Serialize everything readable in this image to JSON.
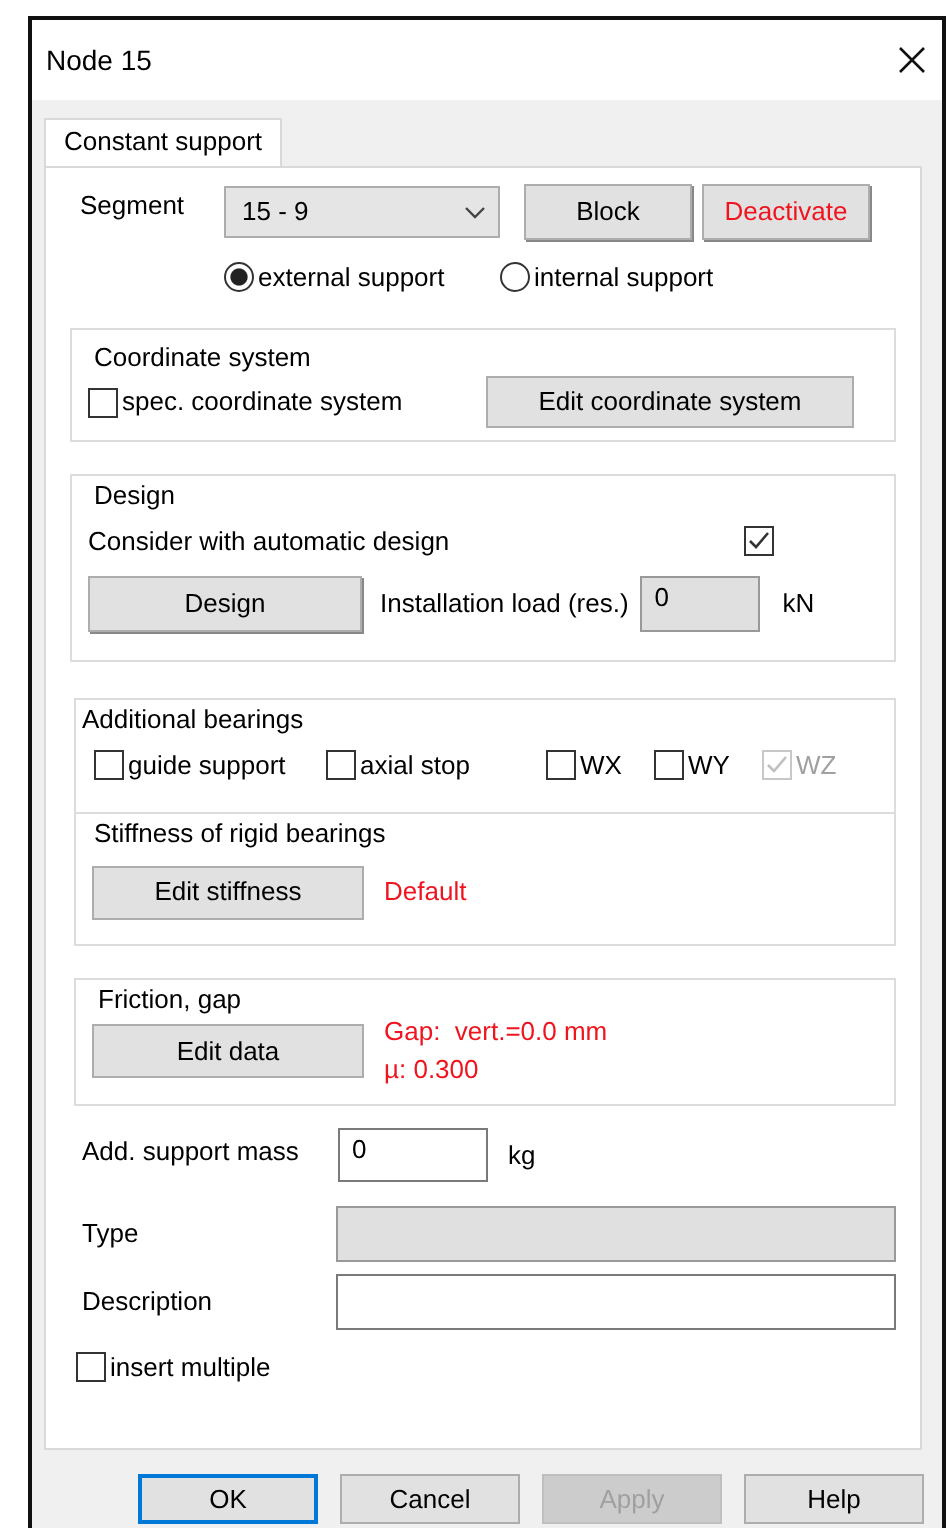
{
  "window": {
    "title": "Node 15"
  },
  "tabs": [
    {
      "label": "Constant support",
      "selected": true
    }
  ],
  "segment": {
    "label": "Segment",
    "value": "15 - 9"
  },
  "segment_buttons": [
    {
      "label": "Block",
      "kind": "normal"
    },
    {
      "label": "Deactivate",
      "kind": "warning"
    }
  ],
  "support_type": [
    {
      "label": "external support",
      "selected": true
    },
    {
      "label": "internal support",
      "selected": false
    }
  ],
  "coordinate_system": {
    "title": "Coordinate system",
    "checkbox": {
      "label": "spec. coordinate system",
      "checked": false
    },
    "button": "Edit coordinate system"
  },
  "design": {
    "title": "Design",
    "consider": {
      "label": "Consider with automatic design",
      "checked": true
    },
    "button": "Design",
    "load_label": "Installation load (res.)",
    "load_value": "0",
    "unit": "kN"
  },
  "additional_bearings": {
    "title": "Additional bearings",
    "options": [
      {
        "label": "guide support",
        "checked": false,
        "disabled": false
      },
      {
        "label": "axial stop",
        "checked": false,
        "disabled": false
      },
      {
        "label": "WX",
        "checked": false,
        "disabled": false
      },
      {
        "label": "WY",
        "checked": false,
        "disabled": false
      },
      {
        "label": "WZ",
        "checked": true,
        "disabled": true
      }
    ],
    "stiffness_title": "Stiffness of rigid bearings",
    "stiffness_button": "Edit stiffness",
    "stiffness_status": "Default"
  },
  "friction": {
    "title": "Friction, gap",
    "button": "Edit data",
    "lines": [
      "Gap:  vert.=0.0 mm",
      "µ: 0.300"
    ]
  },
  "mass": {
    "label": "Add. support mass",
    "value": "0",
    "unit": "kg"
  },
  "type_field": {
    "label": "Type",
    "disabled": true
  },
  "description_field": {
    "label": "Description",
    "disabled": false
  },
  "insert_multiple": {
    "label": "insert multiple",
    "checked": false
  },
  "footer_buttons": [
    {
      "label": "OK",
      "default": true,
      "disabled": false
    },
    {
      "label": "Cancel",
      "default": false,
      "disabled": false
    },
    {
      "label": "Apply",
      "default": false,
      "disabled": true
    },
    {
      "label": "Help",
      "default": false,
      "disabled": false
    }
  ]
}
